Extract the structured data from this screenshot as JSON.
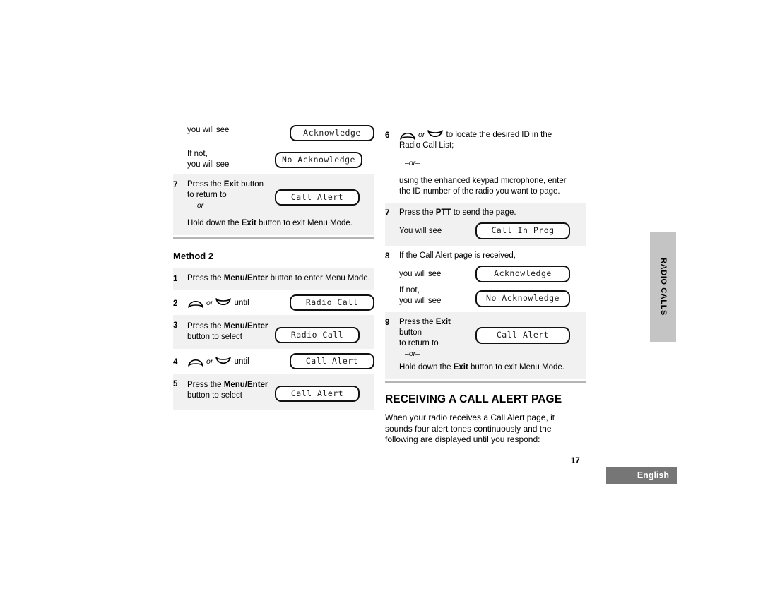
{
  "page": {
    "number": "17",
    "language_tab": "English",
    "side_tab": "RADIO CALLS"
  },
  "left_column": {
    "continued_procedure": {
      "rows": [
        {
          "type": "pair",
          "label": "you will see",
          "lcd": "Acknowledge",
          "shaded": false
        },
        {
          "type": "pair-multiline",
          "label_line1": "If not,",
          "label_line2": "you will see",
          "lcd": "No Acknowledge",
          "shaded": false
        },
        {
          "type": "step",
          "num": "7",
          "text_line1_pre": "Press the ",
          "text_line1_bold": "Exit",
          "text_line1_post": " button",
          "text_line2": "to return to",
          "or": "–or–",
          "lcd": "Call Alert",
          "shaded": true
        },
        {
          "type": "note",
          "text_pre": "Hold down the ",
          "text_bold": "Exit",
          "text_post": " button to exit Menu Mode.",
          "shaded": true
        }
      ]
    },
    "method2": {
      "heading": "Method 2",
      "steps": [
        {
          "num": "1",
          "kind": "text-only",
          "text_pre": "Press the ",
          "text_bold": "Menu/Enter",
          "text_post": " button to enter Menu Mode.",
          "shaded": true
        },
        {
          "num": "2",
          "kind": "rocker",
          "conj": "or",
          "trailing": "until",
          "lcd": "Radio Call",
          "shaded": false
        },
        {
          "num": "3",
          "kind": "two-line",
          "line1_pre": "Press the ",
          "line1_bold": "Menu/Enter",
          "line2": "button to select",
          "lcd": "Radio Call",
          "shaded": true
        },
        {
          "num": "4",
          "kind": "rocker",
          "conj": "or",
          "trailing": "until",
          "lcd": "Call Alert",
          "shaded": false
        },
        {
          "num": "5",
          "kind": "two-line",
          "line1_pre": "Press the ",
          "line1_bold": "Menu/Enter",
          "line2": "button to select",
          "lcd": "Call Alert",
          "shaded": true
        }
      ]
    }
  },
  "right_column": {
    "procedure": {
      "steps": [
        {
          "num": "6",
          "kind": "rocker-sentence",
          "conj": "or",
          "text_line1": "to locate the desired ID in the",
          "text_line2": "Radio Call List;",
          "or": "–or–",
          "note_line1": "using the enhanced keypad microphone, enter",
          "note_line2": "the ID number of the radio you want to page.",
          "shaded": false
        },
        {
          "num": "7",
          "kind": "ptt",
          "text_pre": "Press the ",
          "text_bold": "PTT",
          "text_post": " to send the page.",
          "sub_label": "You will see",
          "lcd": "Call In Prog",
          "shaded": true
        },
        {
          "num": "8",
          "kind": "received",
          "text": "If the Call Alert page is received,",
          "sub_label": "you will see",
          "lcd": "Acknowledge",
          "sub_label2_line1": "If not,",
          "sub_label2_line2": "you will see",
          "lcd2": "No Acknowledge",
          "shaded": false
        },
        {
          "num": "9",
          "kind": "exit",
          "text_line1_pre": "Press the ",
          "text_line1_bold": "Exit",
          "text_line1_post": " button",
          "text_line2": "to return to",
          "or": "–or–",
          "lcd": "Call Alert",
          "note_pre": "Hold down the ",
          "note_bold": "Exit",
          "note_post": " button to exit Menu Mode.",
          "shaded": true
        }
      ]
    },
    "section": {
      "heading": "RECEIVING A CALL ALERT PAGE",
      "paragraph_line1": "When your radio receives a Call Alert page, it",
      "paragraph_line2": "sounds four alert tones continuously and the",
      "paragraph_line3": "following are displayed until you respond:"
    }
  },
  "colors": {
    "row_shade": "#f1f1f1",
    "divider": "#b4b4b4",
    "side_tab": "#c4c4c4",
    "lang_tab": "#767676",
    "text": "#000000"
  }
}
